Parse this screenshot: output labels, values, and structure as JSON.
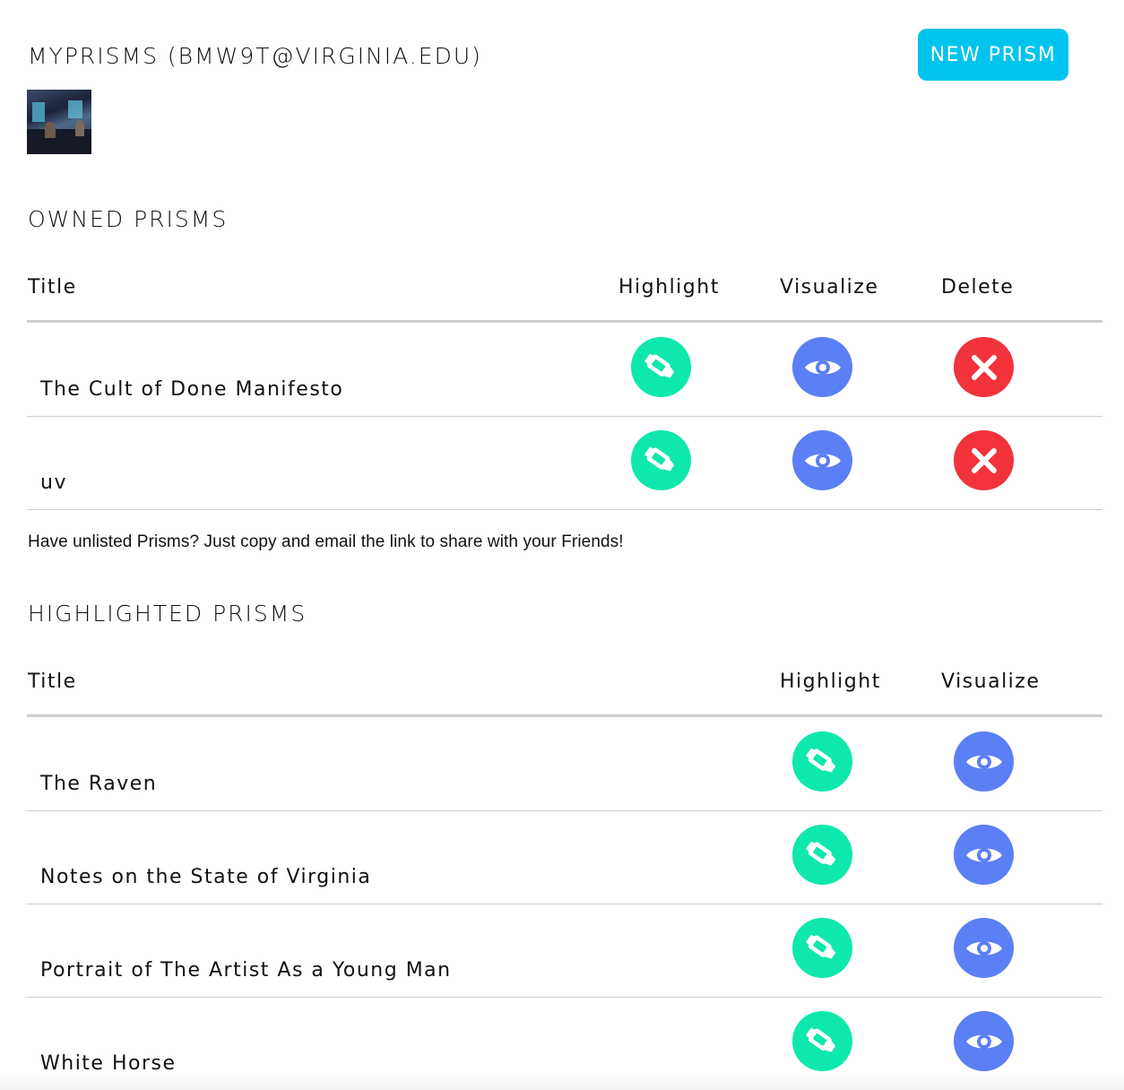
{
  "header": {
    "title": "MYPRISMS (BMW9T@VIRGINIA.EDU)",
    "new_prism_label": "NEW PRISM"
  },
  "colors": {
    "accent": "#00c4ee",
    "highlight": "#0ee8ad",
    "visualize": "#5b7ff4",
    "delete": "#f2333b"
  },
  "owned": {
    "heading": "OWNED PRISMS",
    "columns": {
      "title": "Title",
      "highlight": "Highlight",
      "visualize": "Visualize",
      "delete": "Delete"
    },
    "rows": [
      {
        "title": "The Cult of Done Manifesto",
        "icons": [
          "highlighter-icon",
          "eye-icon",
          "close-icon"
        ]
      },
      {
        "title": "uv",
        "icons": [
          "highlighter-icon",
          "eye-icon",
          "close-icon"
        ]
      }
    ]
  },
  "share_note": "Have unlisted Prisms? Just copy and email the link to share with your Friends!",
  "highlighted": {
    "heading": "HIGHLIGHTED PRISMS",
    "columns": {
      "title": "Title",
      "highlight": "Highlight",
      "visualize": "Visualize"
    },
    "rows": [
      {
        "title": "The Raven",
        "icons": [
          "highlighter-icon",
          "eye-icon"
        ]
      },
      {
        "title": "Notes on the State of Virginia",
        "icons": [
          "highlighter-icon",
          "eye-icon"
        ]
      },
      {
        "title": "Portrait of The Artist As a Young Man",
        "icons": [
          "highlighter-icon",
          "eye-icon"
        ]
      },
      {
        "title": "White Horse",
        "icons": [
          "highlighter-icon",
          "eye-icon"
        ]
      }
    ]
  }
}
